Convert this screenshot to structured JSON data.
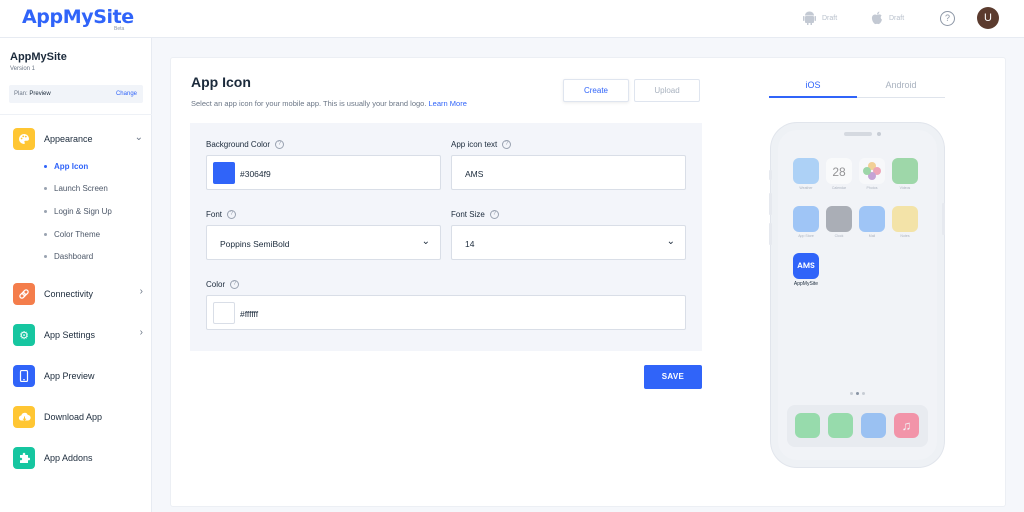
{
  "header": {
    "logo": "AppMySite",
    "logo_badge": "Beta",
    "platforms": [
      {
        "icon": "android-icon",
        "status": "Draft"
      },
      {
        "icon": "apple-icon",
        "status": "Draft"
      }
    ],
    "help_icon": "?",
    "avatar_initial": "U"
  },
  "sidebar": {
    "app_name": "AppMySite",
    "version": "Version 1",
    "plan_label": "Plan:",
    "plan_value": "Preview",
    "plan_change": "Change",
    "items": [
      {
        "label": "Appearance",
        "icon": "palette-icon",
        "color": "#ffc633",
        "expanded": true,
        "subitems": [
          {
            "label": "App Icon",
            "active": true
          },
          {
            "label": "Launch Screen"
          },
          {
            "label": "Login & Sign Up"
          },
          {
            "label": "Color Theme"
          },
          {
            "label": "Dashboard"
          }
        ]
      },
      {
        "label": "Connectivity",
        "icon": "link-icon",
        "color": "#f47d4b"
      },
      {
        "label": "App Settings",
        "icon": "gear-icon",
        "color": "#16c6a0"
      },
      {
        "label": "App Preview",
        "icon": "phone-icon",
        "color": "#3064f9"
      },
      {
        "label": "Download App",
        "icon": "cloud-download-icon",
        "color": "#ffc633"
      },
      {
        "label": "App Addons",
        "icon": "puzzle-icon",
        "color": "#16c6a0"
      }
    ]
  },
  "main": {
    "title": "App Icon",
    "subtitle": "Select an app icon for your mobile app. This is usually your brand logo.",
    "learn_more": "Learn More",
    "create_label": "Create",
    "upload_label": "Upload",
    "save_label": "SAVE",
    "form": {
      "background_color_label": "Background Color",
      "background_color_value": "#3064f9",
      "icon_text_label": "App icon text",
      "icon_text_value": "AMS",
      "font_label": "Font",
      "font_value": "Poppins SemiBold",
      "font_size_label": "Font Size",
      "font_size_value": "14",
      "color_label": "Color",
      "color_value": "#ffffff"
    }
  },
  "preview": {
    "tabs": [
      "iOS",
      "Android"
    ],
    "active_tab": "iOS",
    "app_label": "AppMySite",
    "home_apps": [
      {
        "label": "Weather",
        "color": "#5aa9f5"
      },
      {
        "label": "Calendar",
        "color": "#ffffff",
        "text": "28"
      },
      {
        "label": "Photos",
        "color": "#f5a623"
      },
      {
        "label": "Videos",
        "color": "#39b54a"
      },
      {
        "label": "App Store",
        "color": "#3b8df5"
      },
      {
        "label": "Clock",
        "color": "#555b66"
      },
      {
        "label": "Mail",
        "color": "#3b8df5"
      },
      {
        "label": "Notes",
        "color": "#f7d046"
      }
    ],
    "dock_apps": [
      {
        "name": "messages-icon",
        "color": "#35c759"
      },
      {
        "name": "phone-call-icon",
        "color": "#35c759"
      },
      {
        "name": "safari-icon",
        "color": "#3b8df5"
      },
      {
        "name": "music-icon",
        "color": "#ff2d55"
      }
    ]
  }
}
